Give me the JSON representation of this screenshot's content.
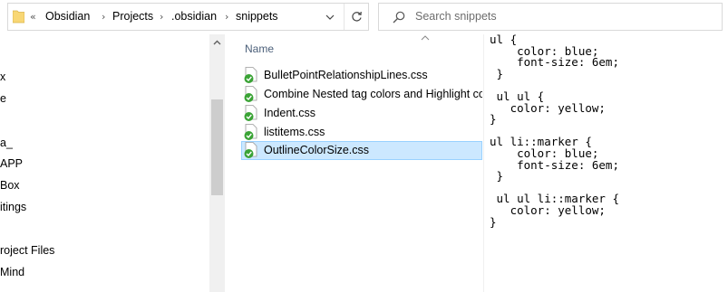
{
  "address_bar": {
    "overflow_label": "«",
    "breadcrumbs": [
      "Obsidian",
      "Projects",
      ".obsidian",
      "snippets"
    ],
    "separator": "›"
  },
  "search": {
    "placeholder": "Search snippets"
  },
  "nav_pane": {
    "items": [
      "x",
      "e",
      "",
      "a_",
      "APP",
      "Box",
      "itings",
      "",
      "roject Files",
      "Mind",
      ""
    ]
  },
  "file_list": {
    "column_header": "Name",
    "sort": "ascending",
    "files": [
      {
        "name": "BulletPointRelationshipLines.css",
        "selected": false,
        "status": "synced"
      },
      {
        "name": "Combine Nested tag colors and Highlight colors.css",
        "selected": false,
        "status": "synced"
      },
      {
        "name": "Indent.css",
        "selected": false,
        "status": "synced"
      },
      {
        "name": "listitems.css",
        "selected": false,
        "status": "synced"
      },
      {
        "name": "OutlineColorSize.css",
        "selected": true,
        "status": "synced"
      }
    ]
  },
  "preview": {
    "code": "ul {\n    color: blue;\n    font-size: 6em;\n }\n\n ul ul {\n   color: yellow;\n}\n\nul li::marker {\n    color: blue;\n    font-size: 6em;\n }\n\n ul ul li::marker {\n   color: yellow;\n}"
  },
  "colors": {
    "selection_bg": "#cce8ff",
    "selection_border": "#99d1ff",
    "header_text": "#4c607a",
    "folder_yellow": "#f8d775",
    "sync_green": "#3aa335"
  }
}
